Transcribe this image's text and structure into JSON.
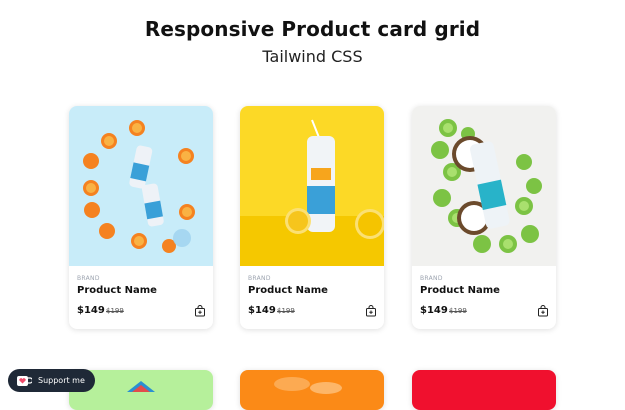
{
  "header": {
    "title": "Responsive Product card grid",
    "subtitle": "Tailwind CSS"
  },
  "cards": [
    {
      "brand": "BRAND",
      "name": "Product Name",
      "price": "$149",
      "old_price": "$199",
      "image_bg": "#c8ecf9"
    },
    {
      "brand": "BRAND",
      "name": "Product Name",
      "price": "$149",
      "old_price": "$199",
      "image_bg": "#fcd926"
    },
    {
      "brand": "BRAND",
      "name": "Product Name",
      "price": "$149",
      "old_price": "$199",
      "image_bg": "#f1f1ef"
    }
  ],
  "second_row_colors": [
    "#b6f09b",
    "#fb8a17",
    "#f0102e"
  ],
  "support": {
    "label": "Support me"
  },
  "icons": {
    "cart": "shopping-bag-icon",
    "support": "heart-cup-icon"
  }
}
